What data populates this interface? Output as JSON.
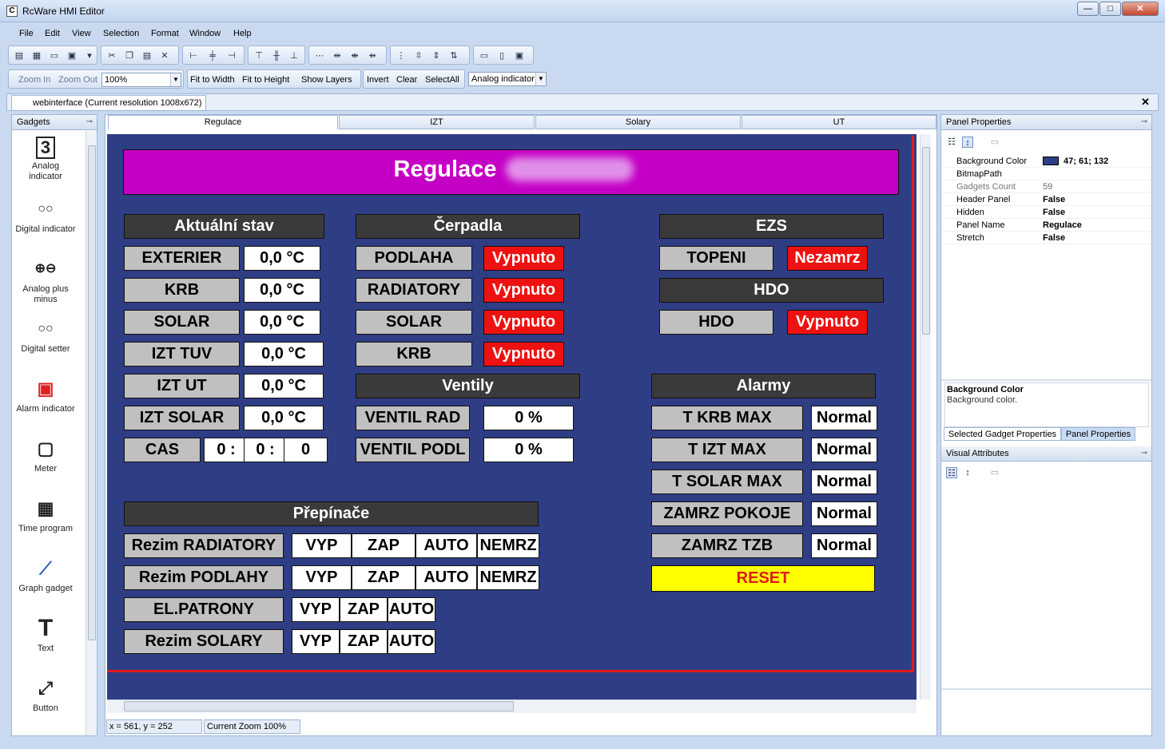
{
  "app": {
    "title": "RcWare HMI Editor",
    "icon_glyph": "C"
  },
  "window_controls": {
    "minimize": "—",
    "maximize": "□",
    "close": "✕"
  },
  "menu": [
    "File",
    "Edit",
    "View",
    "Selection",
    "Format",
    "Window",
    "Help"
  ],
  "toolbar2": {
    "zoom_in": "Zoom In",
    "zoom_out": "Zoom Out",
    "zoom_value": "100%",
    "fit_width": "Fit to Width",
    "fit_height": "Fit to Height",
    "show_layers": "Show Layers",
    "invert": "Invert",
    "clear": "Clear",
    "select_all": "SelectAll",
    "gadget_select": "Analog indicator"
  },
  "document_tab": {
    "label": "webinterface (Current resolution 1008x672)",
    "close": "✕"
  },
  "gadgets": {
    "title": "Gadgets",
    "items": [
      {
        "label": "Analog indicator",
        "icon": "analog-indicator-icon",
        "glyph": "3"
      },
      {
        "label": "Digital indicator",
        "icon": "digital-indicator-icon",
        "glyph": "○○"
      },
      {
        "label": "Analog plus minus",
        "icon": "analog-plus-minus-icon",
        "glyph": "⊕⊖"
      },
      {
        "label": "Digital setter",
        "icon": "digital-setter-icon",
        "glyph": "○○"
      },
      {
        "label": "Alarm indicator",
        "icon": "alarm-indicator-icon",
        "glyph": "▣"
      },
      {
        "label": "Meter",
        "icon": "meter-icon",
        "glyph": "▢"
      },
      {
        "label": "Time program",
        "icon": "time-program-icon",
        "glyph": "▦"
      },
      {
        "label": "Graph gadget",
        "icon": "graph-icon",
        "glyph": "⟋"
      },
      {
        "label": "Text",
        "icon": "text-icon",
        "glyph": "T"
      },
      {
        "label": "Button",
        "icon": "button-icon",
        "glyph": "⤢"
      }
    ]
  },
  "panel_tabs": [
    "Regulace",
    "IZT",
    "Solary",
    "UT"
  ],
  "hmi": {
    "header": "Regulace",
    "aktualni_stav": {
      "title": "Aktuální stav",
      "rows": [
        {
          "label": "EXTERIER",
          "value": "0,0 °C"
        },
        {
          "label": "KRB",
          "value": "0,0 °C"
        },
        {
          "label": "SOLAR",
          "value": "0,0 °C"
        },
        {
          "label": "IZT TUV",
          "value": "0,0 °C"
        },
        {
          "label": "IZT UT",
          "value": "0,0 °C"
        },
        {
          "label": "IZT SOLAR",
          "value": "0,0 °C"
        }
      ],
      "cas": {
        "label": "CAS",
        "h": "0 :",
        "m": "0 :",
        "s": "0"
      }
    },
    "cerpadla": {
      "title": "Čerpadla",
      "rows": [
        {
          "label": "PODLAHA",
          "state": "Vypnuto"
        },
        {
          "label": "RADIATORY",
          "state": "Vypnuto"
        },
        {
          "label": "SOLAR",
          "state": "Vypnuto"
        },
        {
          "label": "KRB",
          "state": "Vypnuto"
        }
      ]
    },
    "ventily": {
      "title": "Ventily",
      "rows": [
        {
          "label": "VENTIL RAD",
          "value": "0 %"
        },
        {
          "label": "VENTIL PODL",
          "value": "0 %"
        }
      ]
    },
    "ezs": {
      "title": "EZS",
      "label": "TOPENI",
      "state": "Nezamrz"
    },
    "hdo": {
      "title": "HDO",
      "label": "HDO",
      "state": "Vypnuto"
    },
    "alarmy": {
      "title": "Alarmy",
      "rows": [
        {
          "label": "T KRB MAX",
          "state": "Normal"
        },
        {
          "label": "T IZT MAX",
          "state": "Normal"
        },
        {
          "label": "T SOLAR MAX",
          "state": "Normal"
        },
        {
          "label": "ZAMRZ POKOJE",
          "state": "Normal"
        },
        {
          "label": "ZAMRZ TZB",
          "state": "Normal"
        }
      ],
      "reset": "RESET"
    },
    "prepinace": {
      "title": "Přepínače",
      "rows": [
        {
          "label": "Rezim RADIATORY",
          "options": [
            "VYP",
            "ZAP",
            "AUTO",
            "NEMRZ"
          ]
        },
        {
          "label": "Rezim PODLAHY",
          "options": [
            "VYP",
            "ZAP",
            "AUTO",
            "NEMRZ"
          ]
        },
        {
          "label": "EL.PATRONY",
          "options": [
            "VYP",
            "ZAP",
            "AUTO"
          ]
        },
        {
          "label": "Rezim SOLARY",
          "options": [
            "VYP",
            "ZAP",
            "AUTO"
          ]
        }
      ]
    }
  },
  "status": {
    "coords": "x = 561, y = 252",
    "zoom": "Current Zoom 100%"
  },
  "panel_properties": {
    "title": "Panel Properties",
    "rows": [
      {
        "key": "Background Color",
        "value": "47; 61; 132",
        "dim": false,
        "swatch": "#2f3d84"
      },
      {
        "key": "BitmapPath",
        "value": "",
        "dim": false
      },
      {
        "key": "Gadgets Count",
        "value": "59",
        "dim": true
      },
      {
        "key": "Header Panel",
        "value": "False",
        "dim": false
      },
      {
        "key": "Hidden",
        "value": "False",
        "dim": false
      },
      {
        "key": "Panel Name",
        "value": "Regulace",
        "dim": false
      },
      {
        "key": "Stretch",
        "value": "False",
        "dim": false
      }
    ],
    "desc_title": "Background Color",
    "desc_text": "Background color."
  },
  "right_tabs": [
    "Selected Gadget Properties",
    "Panel Properties"
  ],
  "visual_attributes": {
    "title": "Visual Attributes"
  },
  "colors": {
    "panel_bg": "#2f3d84",
    "header_bg": "#c400c4",
    "alarm_red": "#ee1111",
    "reset_yellow": "#ffff00"
  }
}
